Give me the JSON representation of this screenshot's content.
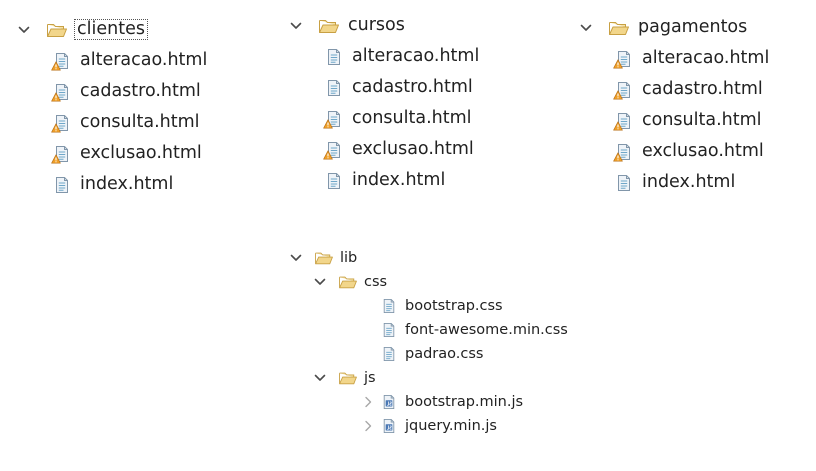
{
  "colors": {
    "folder_fill": "#f2d68b",
    "folder_stroke": "#c8a043",
    "file_bg": "#eef3f8",
    "file_stroke": "#8196aa",
    "warn_fill": "#f0a028",
    "js_blue": "#4a78b5",
    "chevron": "#4b4b4b"
  },
  "trees": [
    {
      "folder": "clientes",
      "files": [
        {
          "name": "alteracao.html",
          "warning": true
        },
        {
          "name": "cadastro.html",
          "warning": true
        },
        {
          "name": "consulta.html",
          "warning": true
        },
        {
          "name": "exclusao.html",
          "warning": true
        },
        {
          "name": "index.html",
          "warning": false
        }
      ]
    },
    {
      "folder": "cursos",
      "files": [
        {
          "name": "alteracao.html",
          "warning": false
        },
        {
          "name": "cadastro.html",
          "warning": false
        },
        {
          "name": "consulta.html",
          "warning": true
        },
        {
          "name": "exclusao.html",
          "warning": true
        },
        {
          "name": "index.html",
          "warning": false
        }
      ]
    },
    {
      "folder": "pagamentos",
      "files": [
        {
          "name": "alteracao.html",
          "warning": true
        },
        {
          "name": "cadastro.html",
          "warning": true
        },
        {
          "name": "consulta.html",
          "warning": true
        },
        {
          "name": "exclusao.html",
          "warning": true
        },
        {
          "name": "index.html",
          "warning": false
        }
      ]
    }
  ],
  "lib": {
    "folder": "lib",
    "css": {
      "folder": "css",
      "files": [
        "bootstrap.css",
        "font-awesome.min.css",
        "padrao.css"
      ]
    },
    "js": {
      "folder": "js",
      "files": [
        "bootstrap.min.js",
        "jquery.min.js"
      ]
    }
  }
}
